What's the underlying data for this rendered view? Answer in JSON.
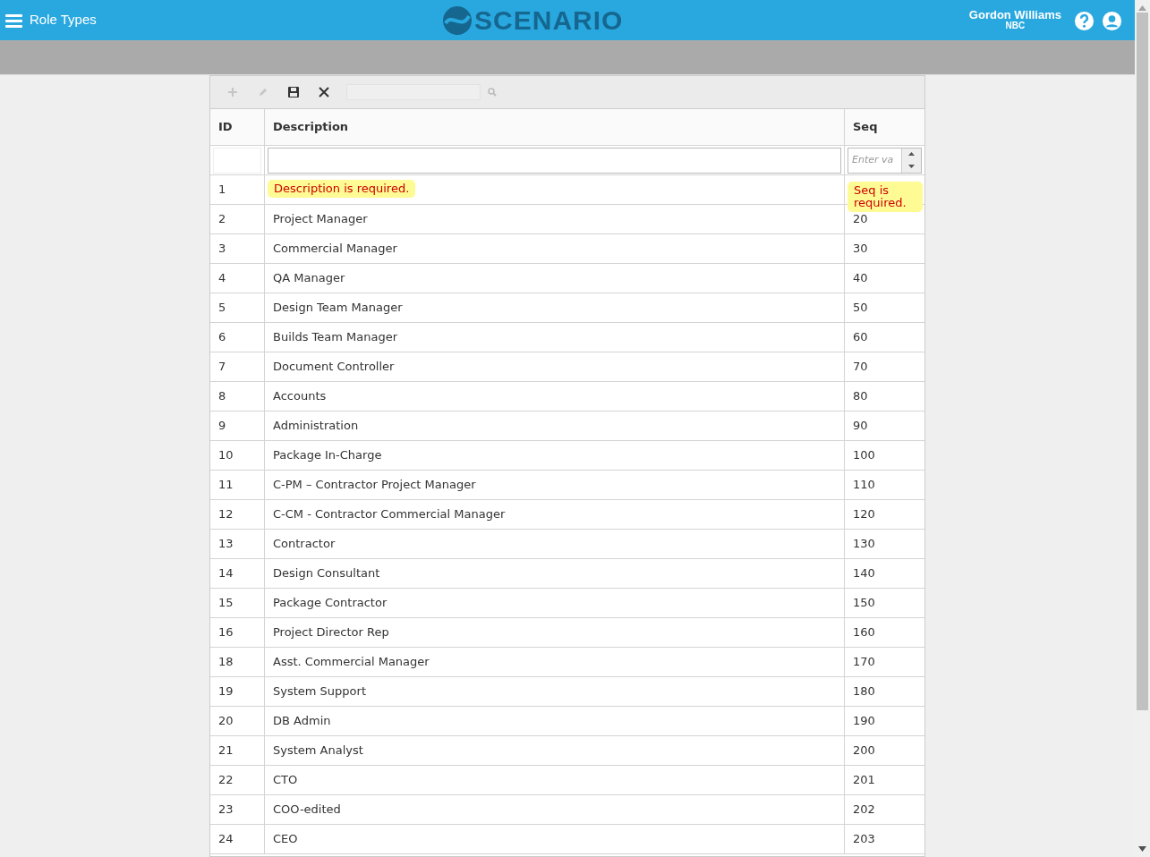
{
  "app_bar": {
    "menu_title": "Role Types",
    "logo": "SCENARIO",
    "user_name": "Gordon Williams",
    "user_org": "NBC"
  },
  "toolbar": {
    "buttons": [
      {
        "kind": "add",
        "disabled": true
      },
      {
        "kind": "edit",
        "disabled": true
      },
      {
        "kind": "save",
        "disabled": false
      },
      {
        "kind": "cancel",
        "disabled": false
      }
    ],
    "search": {
      "disabled": true
    }
  },
  "table": {
    "columns": [
      "ID",
      "Description",
      "Seq"
    ],
    "new_row": {
      "seq_placeholder": "Enter va",
      "description_error": "Description is required.",
      "seq_error": "Seq is required."
    },
    "rows": [
      {
        "number": "1"
      },
      {
        "number": "2",
        "description": "Project Manager",
        "seq": "20"
      },
      {
        "number": "3",
        "description": "Commercial Manager",
        "seq": "30"
      },
      {
        "number": "4",
        "description": "QA Manager",
        "seq": "40"
      },
      {
        "number": "5",
        "description": "Design Team Manager",
        "seq": "50"
      },
      {
        "number": "6",
        "description": "Builds Team Manager",
        "seq": "60"
      },
      {
        "number": "7",
        "description": "Document Controller",
        "seq": "70"
      },
      {
        "number": "8",
        "description": "Accounts",
        "seq": "80"
      },
      {
        "number": "9",
        "description": "Administration",
        "seq": "90"
      },
      {
        "number": "10",
        "description": "Package In-Charge",
        "seq": "100"
      },
      {
        "number": "11",
        "description": "C-PM – Contractor Project Manager",
        "seq": "110"
      },
      {
        "number": "12",
        "description": "C-CM - Contractor Commercial Manager",
        "seq": "120"
      },
      {
        "number": "13",
        "description": "Contractor",
        "seq": "130"
      },
      {
        "number": "14",
        "description": "Design Consultant",
        "seq": "140"
      },
      {
        "number": "15",
        "description": "Package Contractor",
        "seq": "150"
      },
      {
        "number": "16",
        "description": "Project Director Rep",
        "seq": "160"
      },
      {
        "number": "18",
        "description": "Asst. Commercial Manager",
        "seq": "170"
      },
      {
        "number": "19",
        "description": "System Support",
        "seq": "180"
      },
      {
        "number": "20",
        "description": "DB Admin",
        "seq": "190"
      },
      {
        "number": "21",
        "description": "System Analyst",
        "seq": "200"
      },
      {
        "number": "22",
        "description": "CTO",
        "seq": "201"
      },
      {
        "number": "23",
        "description": "COO-edited",
        "seq": "202"
      },
      {
        "number": "24",
        "description": "CEO",
        "seq": "203"
      }
    ]
  }
}
